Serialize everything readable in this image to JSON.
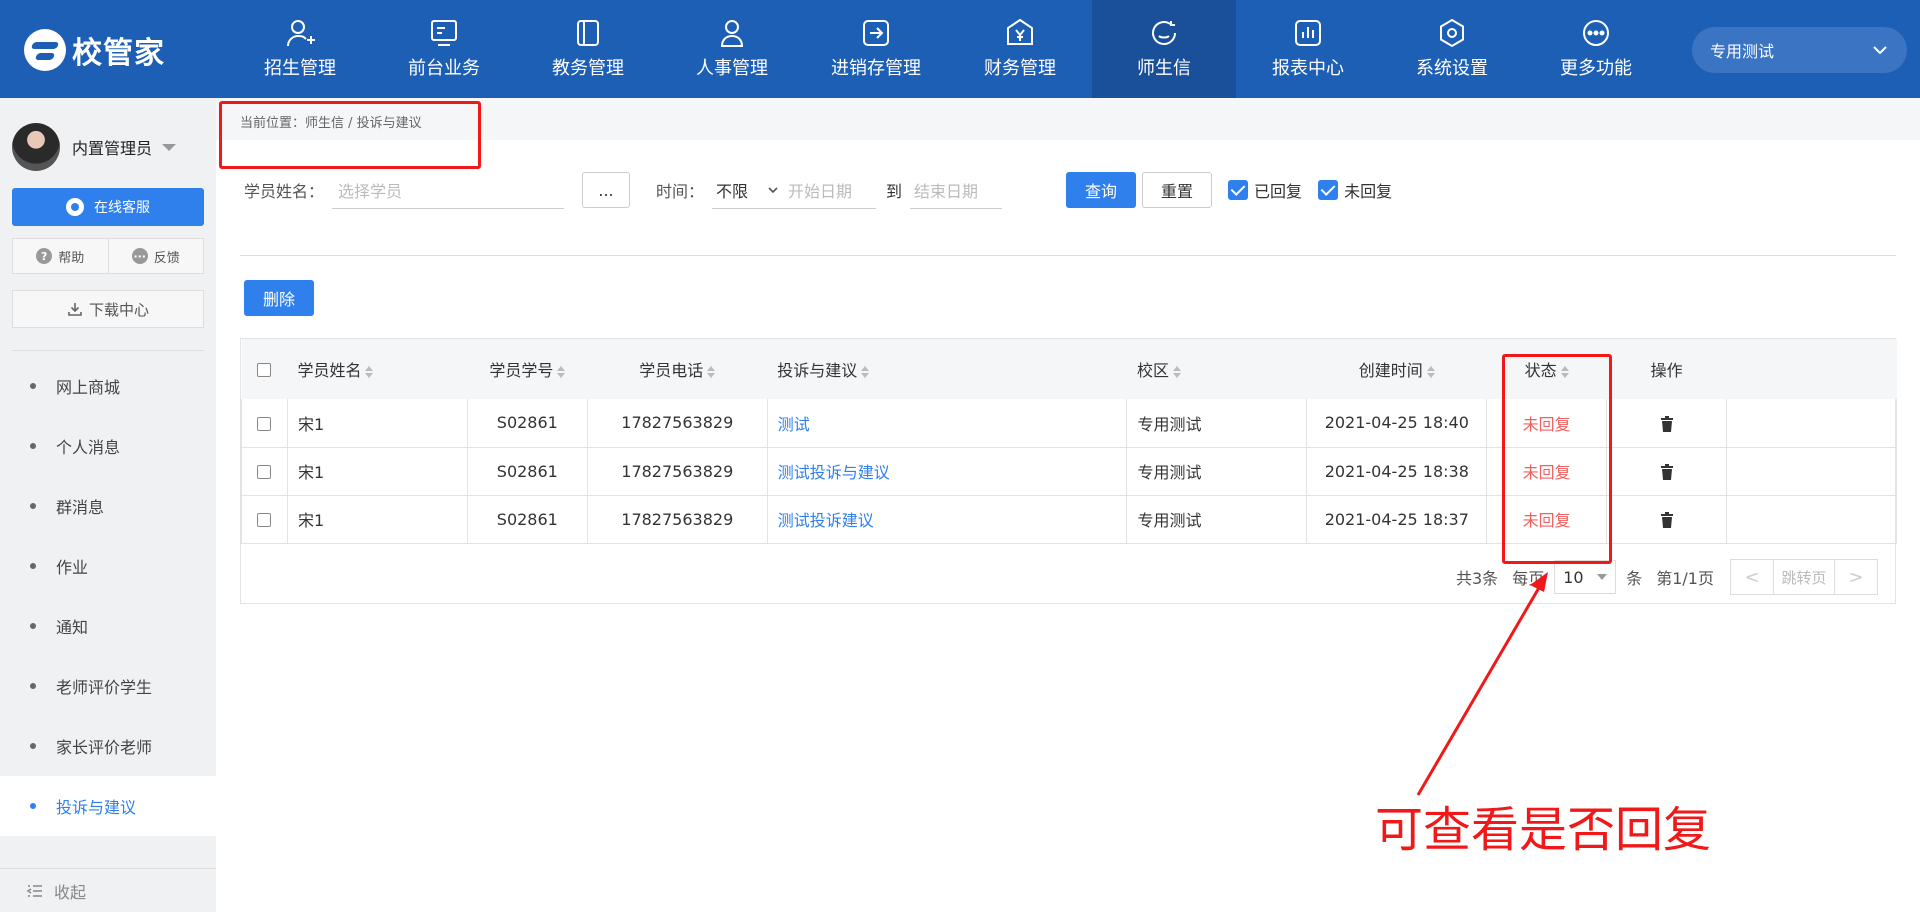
{
  "app": {
    "logo_text": "校管家"
  },
  "nav": [
    {
      "label": "招生管理",
      "icon": "person-add-icon"
    },
    {
      "label": "前台业务",
      "icon": "monitor-icon"
    },
    {
      "label": "教务管理",
      "icon": "book-icon"
    },
    {
      "label": "人事管理",
      "icon": "person-icon"
    },
    {
      "label": "进销存管理",
      "icon": "arrow-box-icon"
    },
    {
      "label": "财务管理",
      "icon": "yen-shield-icon"
    },
    {
      "label": "师生信",
      "icon": "chat-icon",
      "active": true
    },
    {
      "label": "报表中心",
      "icon": "chart-icon"
    },
    {
      "label": "系统设置",
      "icon": "settings-icon"
    },
    {
      "label": "更多功能",
      "icon": "more-icon"
    }
  ],
  "school_select": {
    "value": "专用测试"
  },
  "sidebar": {
    "user_name": "内置管理员",
    "service_label": "在线客服",
    "help_label": "帮助",
    "feedback_label": "反馈",
    "download_label": "下载中心",
    "menu": [
      {
        "label": "网上商城"
      },
      {
        "label": "个人消息"
      },
      {
        "label": "群消息"
      },
      {
        "label": "作业"
      },
      {
        "label": "通知"
      },
      {
        "label": "老师评价学生"
      },
      {
        "label": "家长评价老师"
      },
      {
        "label": "投诉与建议",
        "active": true
      }
    ],
    "collapse_label": "收起"
  },
  "breadcrumb": "当前位置：师生信 / 投诉与建议",
  "filters": {
    "student_label": "学员姓名：",
    "student_placeholder": "选择学员",
    "more_btn": "...",
    "time_label": "时间：",
    "time_value": "不限",
    "start_placeholder": "开始日期",
    "to_label": "到",
    "end_placeholder": "结束日期",
    "query_label": "查询",
    "reset_label": "重置",
    "replied_label": "已回复",
    "unreplied_label": "未回复"
  },
  "delete_label": "删除",
  "table": {
    "headers": [
      "学员姓名",
      "学员学号",
      "学员电话",
      "投诉与建议",
      "校区",
      "创建时间",
      "状态",
      "操作"
    ],
    "rows": [
      {
        "name": "宋1",
        "id": "S02861",
        "phone": "17827563829",
        "content": "测试",
        "campus": "专用测试",
        "time": "2021-04-25 18:40",
        "status": "未回复"
      },
      {
        "name": "宋1",
        "id": "S02861",
        "phone": "17827563829",
        "content": "测试投诉与建议",
        "campus": "专用测试",
        "time": "2021-04-25 18:38",
        "status": "未回复"
      },
      {
        "name": "宋1",
        "id": "S02861",
        "phone": "17827563829",
        "content": "测试投诉建议",
        "campus": "专用测试",
        "time": "2021-04-25 18:37",
        "status": "未回复"
      }
    ]
  },
  "pager": {
    "total": "共3条",
    "per_page_label": "每页",
    "per_page": "10",
    "unit": "条",
    "page": "第1/1页",
    "jump": "跳转页",
    "prev": "<",
    "next": ">"
  },
  "annotation": "可查看是否回复",
  "colors": {
    "primary": "#2f80ed",
    "topbar": "#1d5fb5",
    "highlight": "#f01818",
    "status": "#f06060"
  }
}
